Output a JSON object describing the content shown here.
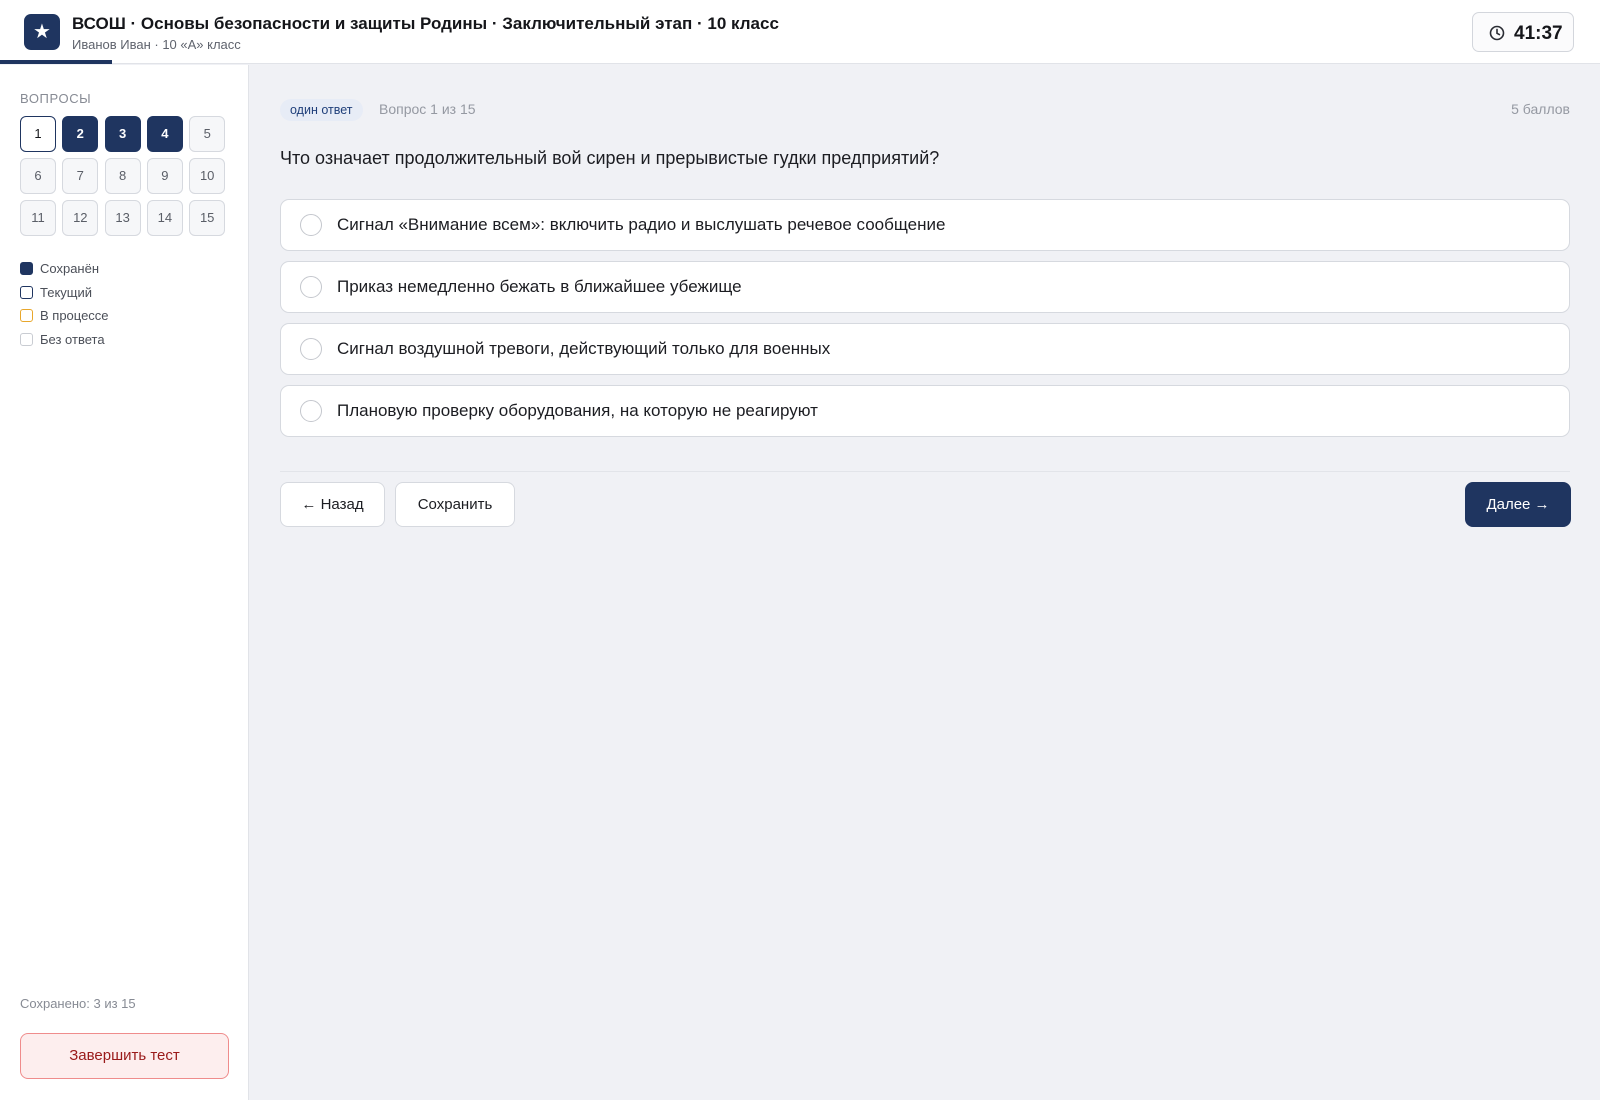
{
  "header": {
    "title": "ВСОШ · Основы безопасности и защиты Родины · Заключительный этап · 10 класс",
    "subtitle": "Иванов Иван · 10 «А» класс",
    "logo_icon": "star-icon",
    "timer": "41:37",
    "timer_icon": "clock-icon",
    "progress_fraction": 0.07
  },
  "sidebar": {
    "heading": "ВОПРОСЫ",
    "questions": [
      {
        "label": "1",
        "state": "current"
      },
      {
        "label": "2",
        "state": "saved"
      },
      {
        "label": "3",
        "state": "saved"
      },
      {
        "label": "4",
        "state": "saved"
      },
      {
        "label": "5",
        "state": "unanswered"
      },
      {
        "label": "6",
        "state": "unanswered"
      },
      {
        "label": "7",
        "state": "unanswered"
      },
      {
        "label": "8",
        "state": "unanswered"
      },
      {
        "label": "9",
        "state": "unanswered"
      },
      {
        "label": "10",
        "state": "unanswered"
      },
      {
        "label": "11",
        "state": "unanswered"
      },
      {
        "label": "12",
        "state": "unanswered"
      },
      {
        "label": "13",
        "state": "unanswered"
      },
      {
        "label": "14",
        "state": "unanswered"
      },
      {
        "label": "15",
        "state": "unanswered"
      }
    ],
    "legend": [
      {
        "label": "Сохранён",
        "color": "#1f3560",
        "style": "filled"
      },
      {
        "label": "Текущий",
        "color": "#1f3560",
        "style": "outline"
      },
      {
        "label": "В процессе",
        "color": "#e8a72c",
        "style": "outline"
      },
      {
        "label": "Без ответа",
        "color": "#c9ccd2",
        "style": "outline"
      }
    ],
    "saved_count": "Сохранено: 3 из 15",
    "finish_label": "Завершить тест"
  },
  "main": {
    "badge": "один ответ",
    "question_number": "Вопрос 1 из 15",
    "points": "5 баллов",
    "question_text": "Что означает продолжительный вой сирен и прерывистые гудки предприятий?",
    "options": [
      "Сигнал «Внимание всем»: включить радио и выслушать речевое сообщение",
      "Приказ немедленно бежать в ближайшее убежище",
      "Сигнал воздушной тревоги, действующий только для военных",
      "Плановую проверку оборудования, на которую не реагируют"
    ],
    "back_label": "← Назад",
    "save_label": "Сохранить",
    "next_label": "Далее →"
  },
  "colors": {
    "accent": "#1f3560",
    "danger": "#9a1a1a",
    "danger_bg": "#fdeeee"
  }
}
